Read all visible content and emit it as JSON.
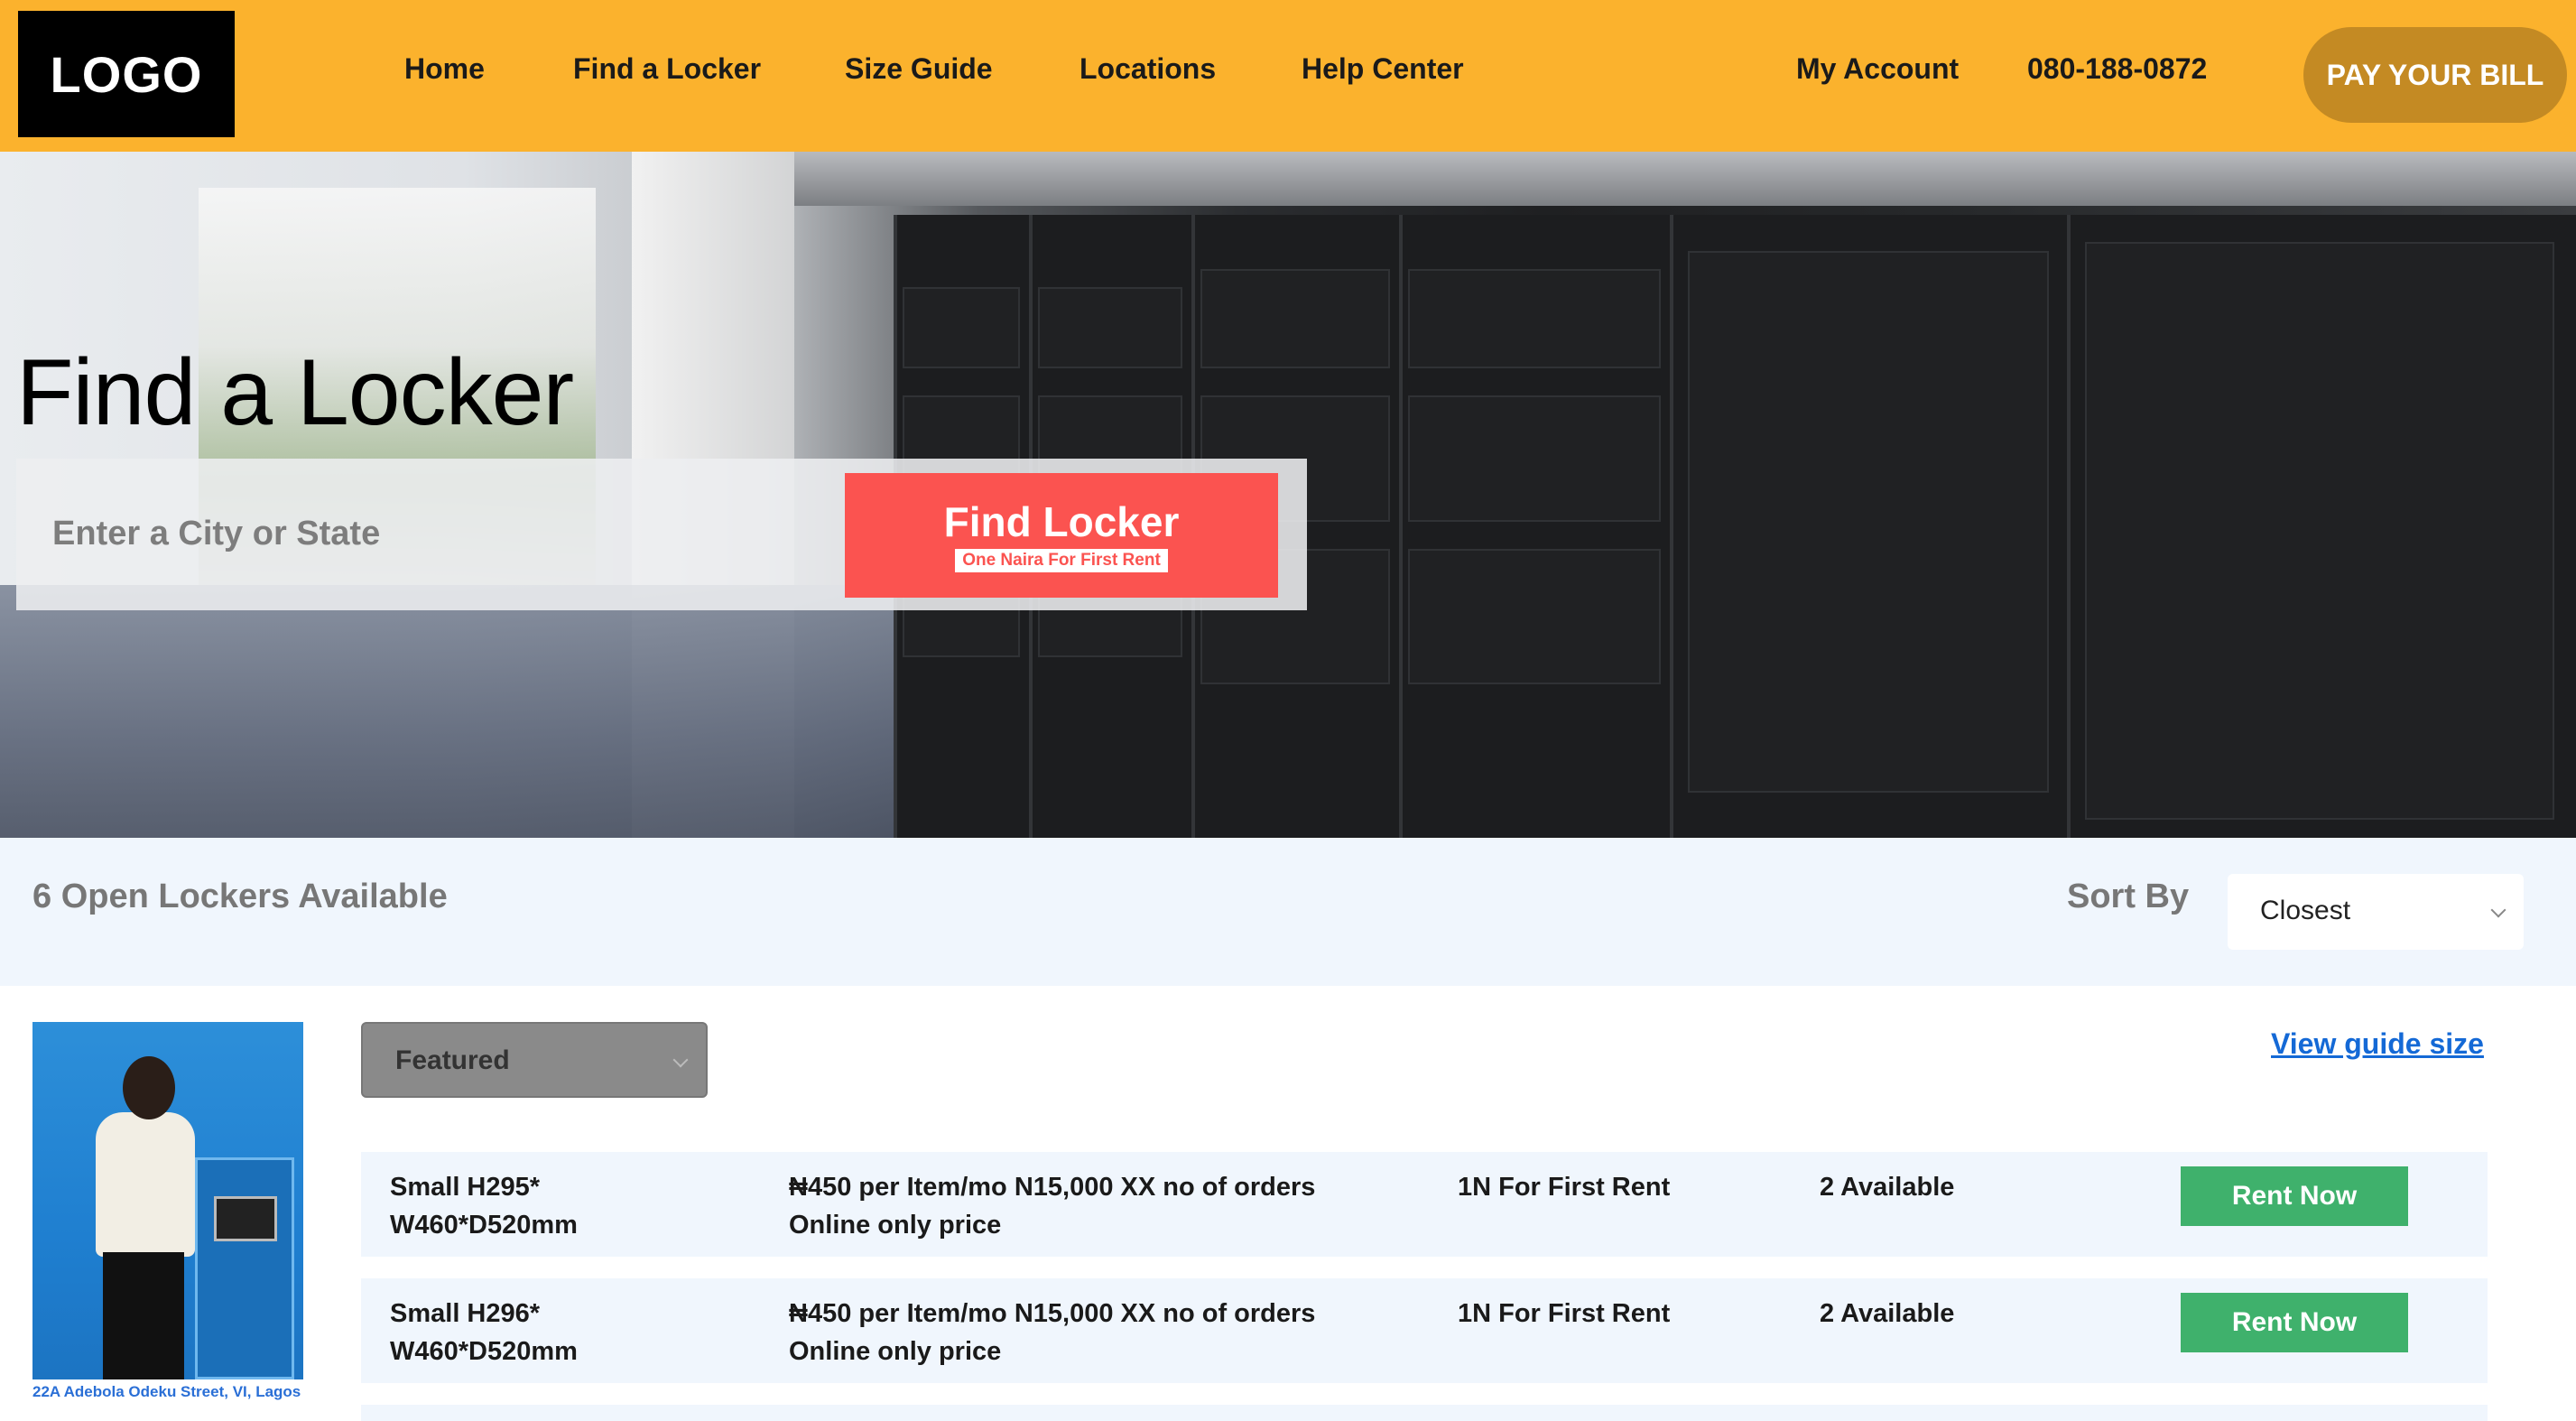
{
  "header": {
    "logo": "LOGO",
    "nav": [
      "Home",
      "Find a Locker",
      "Size Guide",
      "Locations",
      "Help Center"
    ],
    "account": "My Account",
    "phone": "080-188-0872",
    "pay_button": "PAY YOUR BILL"
  },
  "hero": {
    "title": "Find a Locker",
    "search_placeholder": "Enter a City or State",
    "find_button": "Find Locker",
    "find_button_sub": "One Naira For First Rent"
  },
  "results": {
    "count_text": "6 Open Lockers Available",
    "sort_label": "Sort By",
    "sort_value": "Closest"
  },
  "listing": {
    "location_caption": "22A Adebola Odeku Street, VI, Lagos",
    "filter_value": "Featured",
    "guide_link": "View guide size",
    "rows": [
      {
        "size": "Small H295* W460*D520mm",
        "price": "₦450 per Item/mo N15,000 XX no of orders Online only price",
        "promo": "1N For First Rent",
        "availability": "2 Available",
        "button": "Rent Now"
      },
      {
        "size": "Small H296* W460*D520mm",
        "price": "₦450 per Item/mo N15,000 XX no of orders Online only price",
        "promo": "1N For First Rent",
        "availability": "2 Available",
        "button": "Rent Now"
      }
    ]
  },
  "colors": {
    "topbar": "#fbb22d",
    "pay_button": "#c48a23",
    "find_button": "#fb5350",
    "rent_button": "#3fb16c",
    "row_background": "#f0f6fd",
    "link": "#1469d6"
  }
}
